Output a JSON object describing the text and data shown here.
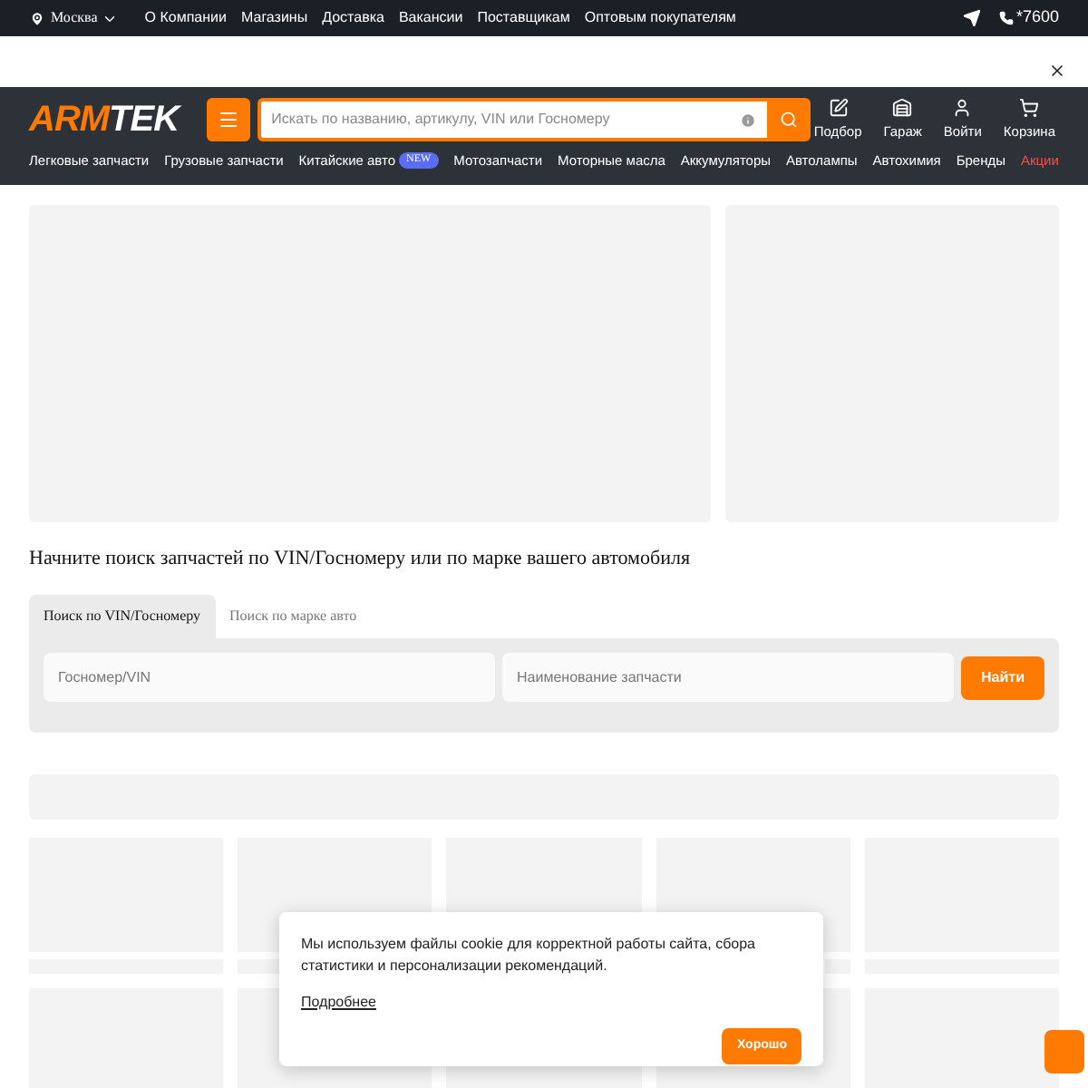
{
  "top_bar": {
    "city": "Москва",
    "links": [
      "О Компании",
      "Магазины",
      "Доставка",
      "Вакансии",
      "Поставщикам",
      "Оптовым покупателям"
    ],
    "phone": "*7600"
  },
  "header": {
    "logo": {
      "accent": "ARM",
      "rest": "TEK"
    },
    "search": {
      "placeholder": "Искать по названию, артикулу, VIN или Госномеру"
    },
    "actions": [
      {
        "label": "Подбор",
        "kind": "edit"
      },
      {
        "label": "Гараж",
        "kind": "garage"
      },
      {
        "label": "Войти",
        "kind": "user"
      },
      {
        "label": "Корзина",
        "kind": "cart"
      }
    ],
    "nav": [
      {
        "label": "Легковые запчасти",
        "highlight": false
      },
      {
        "label": "Грузовые запчасти",
        "highlight": false
      },
      {
        "label": "Китайские авто",
        "badge": "NEW",
        "highlight": false
      },
      {
        "label": "Мотозапчасти",
        "highlight": false
      },
      {
        "label": "Моторные масла",
        "highlight": false
      },
      {
        "label": "Аккумуляторы",
        "highlight": false
      },
      {
        "label": "Автолампы",
        "highlight": false
      },
      {
        "label": "Автохимия",
        "highlight": false
      },
      {
        "label": "Бренды",
        "highlight": false
      },
      {
        "label": "Акции",
        "highlight": true
      }
    ]
  },
  "vin_search": {
    "heading": "Начните поиск запчастей по VIN/Госномеру или по марке вашего автомобиля",
    "tabs": [
      {
        "label": "Поиск по VIN/Госномеру",
        "selected": true
      },
      {
        "label": "Поиск по марке авто",
        "selected": false
      }
    ],
    "fields": [
      {
        "placeholder": "Госномер/VIN"
      },
      {
        "placeholder": "Наименование запчасти"
      }
    ],
    "button": "Найти"
  },
  "cookie_notice": {
    "text": "Мы используем файлы cookie для корректной работы сайта, сбора статистики и персонализации рекомендаций.",
    "link": "Подробнее",
    "button": "Хорошо"
  }
}
